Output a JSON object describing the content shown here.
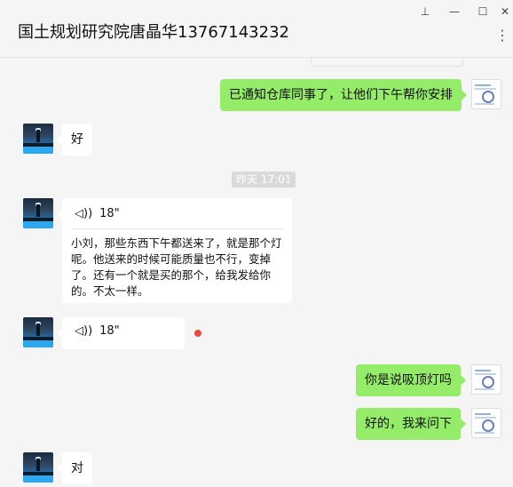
{
  "window": {
    "title": "国土规划研究院唐晶华13767143232",
    "pin_icon": "pin-icon",
    "minimize_icon": "minimize-icon",
    "maximize_icon": "maximize-icon",
    "close_icon": "close-icon",
    "more_icon": "more-icon",
    "pin_glyph": "⊥",
    "min_glyph": "—",
    "max_glyph": "☐",
    "close_glyph": "✕",
    "more_glyph": "⋮"
  },
  "time_divider": "昨天 17:01",
  "messages": [
    {
      "side": "right",
      "type": "text",
      "text": "已通知仓库同事了，让他们下午帮你安排"
    },
    {
      "side": "left",
      "type": "text",
      "text": "好"
    },
    {
      "side": "left",
      "type": "voice",
      "duration": "18\"",
      "transcript": "小刘，那些东西下午都送来了，就是那个灯呢。他送来的时候可能质量也不行，变掉了。还有一个就是买的那个，给我发给你的。不太一样。"
    },
    {
      "side": "left",
      "type": "voice",
      "duration": "18\"",
      "unread": true
    },
    {
      "side": "right",
      "type": "text",
      "text": "你是说吸顶灯吗"
    },
    {
      "side": "right",
      "type": "text",
      "text": "好的，我来问下"
    },
    {
      "side": "left",
      "type": "text",
      "text": "对"
    }
  ],
  "colors": {
    "background": "#f5f5f5",
    "self_bubble": "#95ec69",
    "other_bubble": "#ffffff",
    "unread_dot": "#f04a3f",
    "time_chip": "#dadada"
  }
}
